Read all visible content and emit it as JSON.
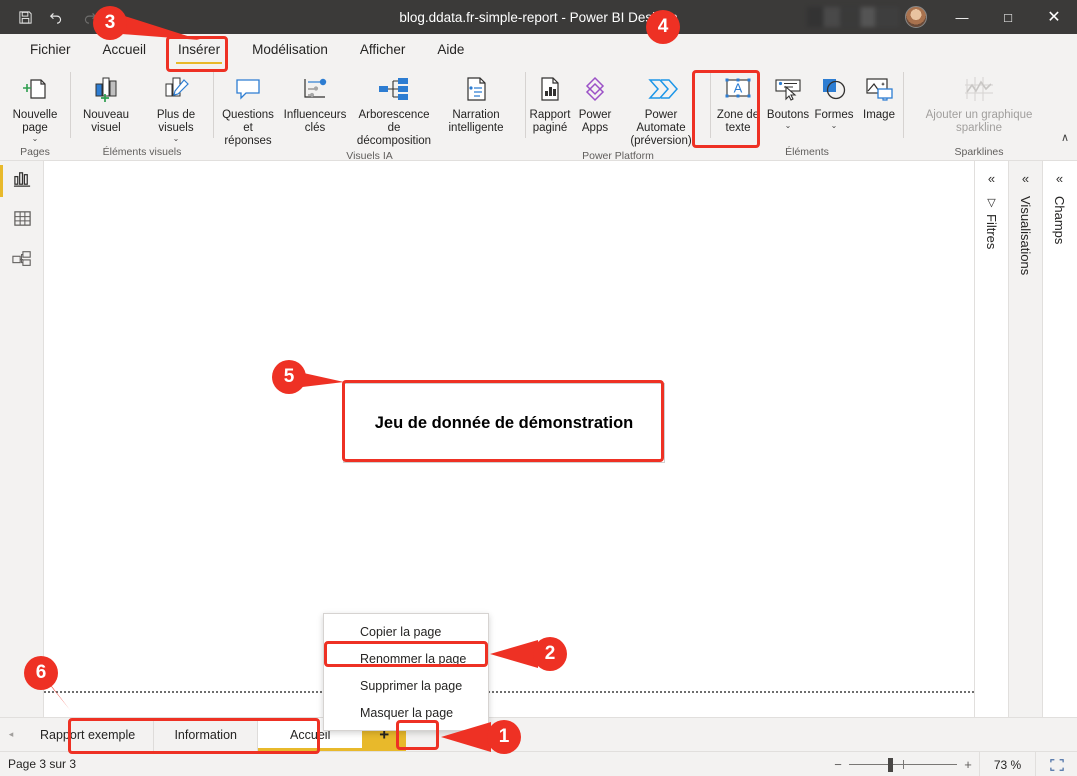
{
  "window": {
    "title": "blog.ddata.fr-simple-report - Power BI Desktop",
    "quick_access": {
      "save": "save-icon",
      "undo": "undo-icon",
      "redo": "redo-icon"
    },
    "controls": {
      "minimize": "—",
      "maximize": "□",
      "close": "✕"
    }
  },
  "menubar": {
    "tabs": [
      {
        "label": "Fichier",
        "active": false
      },
      {
        "label": "Accueil",
        "active": false
      },
      {
        "label": "Insérer",
        "active": true
      },
      {
        "label": "Modélisation",
        "active": false
      },
      {
        "label": "Afficher",
        "active": false
      },
      {
        "label": "Aide",
        "active": false
      }
    ]
  },
  "ribbon": {
    "groups": [
      {
        "name": "pages",
        "label": "Pages",
        "buttons": [
          {
            "label": "Nouvelle page",
            "caret": true,
            "disabled": false,
            "icon": "new-page-icon"
          }
        ]
      },
      {
        "name": "elements-visuels",
        "label": "Éléments visuels",
        "buttons": [
          {
            "label": "Nouveau visuel",
            "caret": false,
            "disabled": false,
            "icon": "new-visual-icon"
          },
          {
            "label": "Plus de visuels",
            "caret": true,
            "disabled": false,
            "icon": "more-visuals-icon"
          }
        ]
      },
      {
        "name": "visuels-ia",
        "label": "Visuels IA",
        "buttons": [
          {
            "label": "Questions et réponses",
            "caret": false,
            "disabled": false,
            "icon": "qna-icon"
          },
          {
            "label": "Influenceurs clés",
            "caret": false,
            "disabled": false,
            "icon": "key-influencers-icon"
          },
          {
            "label": "Arborescence de décomposition",
            "caret": false,
            "disabled": false,
            "icon": "decomposition-tree-icon"
          },
          {
            "label": "Narration intelligente",
            "caret": false,
            "disabled": false,
            "icon": "smart-narrative-icon"
          }
        ]
      },
      {
        "name": "power-platform",
        "label": "Power Platform",
        "buttons": [
          {
            "label": "Rapport paginé",
            "caret": false,
            "disabled": false,
            "icon": "paginated-report-icon"
          },
          {
            "label": "Power Apps",
            "caret": false,
            "disabled": false,
            "icon": "power-apps-icon"
          },
          {
            "label": "Power Automate (préversion)",
            "caret": false,
            "disabled": false,
            "icon": "power-automate-icon"
          }
        ]
      },
      {
        "name": "elements",
        "label": "Éléments",
        "buttons": [
          {
            "label": "Zone de texte",
            "caret": false,
            "disabled": false,
            "icon": "text-box-icon"
          },
          {
            "label": "Boutons",
            "caret": true,
            "disabled": false,
            "icon": "buttons-icon"
          },
          {
            "label": "Formes",
            "caret": true,
            "disabled": false,
            "icon": "shapes-icon"
          },
          {
            "label": "Image",
            "caret": false,
            "disabled": false,
            "icon": "image-icon"
          }
        ]
      },
      {
        "name": "sparklines",
        "label": "Sparklines",
        "buttons": [
          {
            "label": "Ajouter un graphique sparkline",
            "caret": false,
            "disabled": true,
            "icon": "sparkline-icon"
          }
        ]
      }
    ],
    "collapse_glyph": "∧"
  },
  "left_views": [
    {
      "name": "report-view",
      "icon": "report-chart-icon",
      "active": true
    },
    {
      "name": "data-view",
      "icon": "table-grid-icon",
      "active": false
    },
    {
      "name": "model-view",
      "icon": "model-relationship-icon",
      "active": false
    }
  ],
  "canvas": {
    "textbox_value": "Jeu de donnée de démonstration"
  },
  "right_panes": [
    {
      "name": "filters",
      "title": "Filtres",
      "chevron": "«",
      "glyph": "filter-icon",
      "gray": false
    },
    {
      "name": "visualizations",
      "title": "Visualisations",
      "chevron": "«",
      "glyph": null,
      "gray": true
    },
    {
      "name": "fields",
      "title": "Champs",
      "chevron": "«",
      "glyph": null,
      "gray": false
    }
  ],
  "context_menu": {
    "items": [
      {
        "label": "Copier la page",
        "highlighted": false
      },
      {
        "label": "Renommer la page",
        "highlighted": true
      },
      {
        "label": "Supprimer la page",
        "highlighted": false
      },
      {
        "label": "Masquer la page",
        "highlighted": false
      }
    ]
  },
  "page_tabs": {
    "scroll_left": "◂",
    "scroll_right": "▸",
    "tabs": [
      {
        "label": "Rapport exemple",
        "active": false
      },
      {
        "label": "Information",
        "active": false
      },
      {
        "label": "Accueil",
        "active": true
      }
    ],
    "add_label": "+"
  },
  "status": {
    "page_indicator": "Page 3 sur 3",
    "zoom_minus": "−",
    "zoom_plus": "+",
    "zoom_percent": "73 %",
    "fit_icon": "fit-to-page-icon"
  },
  "annotations": {
    "accent_color": "#EE3124",
    "callouts": [
      {
        "number": "1"
      },
      {
        "number": "2"
      },
      {
        "number": "3"
      },
      {
        "number": "4"
      },
      {
        "number": "5"
      },
      {
        "number": "6"
      }
    ]
  }
}
